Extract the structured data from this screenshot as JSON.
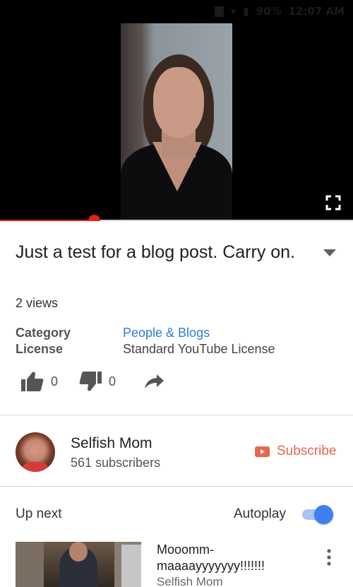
{
  "status_bar": {
    "battery": "90%",
    "time": "12:07 AM"
  },
  "player": {
    "progress": 0.265
  },
  "video": {
    "title": "Just a test for a blog post. Carry on.",
    "views": "2 views",
    "category_label": "Category",
    "category_value": "People & Blogs",
    "license_label": "License",
    "license_value": "Standard YouTube License",
    "likes": "0",
    "dislikes": "0"
  },
  "channel": {
    "name": "Selfish Mom",
    "subscribers": "561 subscribers",
    "subscribe_label": "Subscribe"
  },
  "up_next": {
    "label": "Up next",
    "autoplay_label": "Autoplay",
    "autoplay_on": true,
    "items": [
      {
        "title": "Mooomm-maaaayyyyyyy!!!!!!!",
        "channel": "Selfish Mom"
      }
    ]
  },
  "colors": {
    "accent_red": "#e62117",
    "link_blue": "#2c7fd1",
    "subscribe": "#e6674f",
    "toggle_blue": "#3f7ff0"
  }
}
